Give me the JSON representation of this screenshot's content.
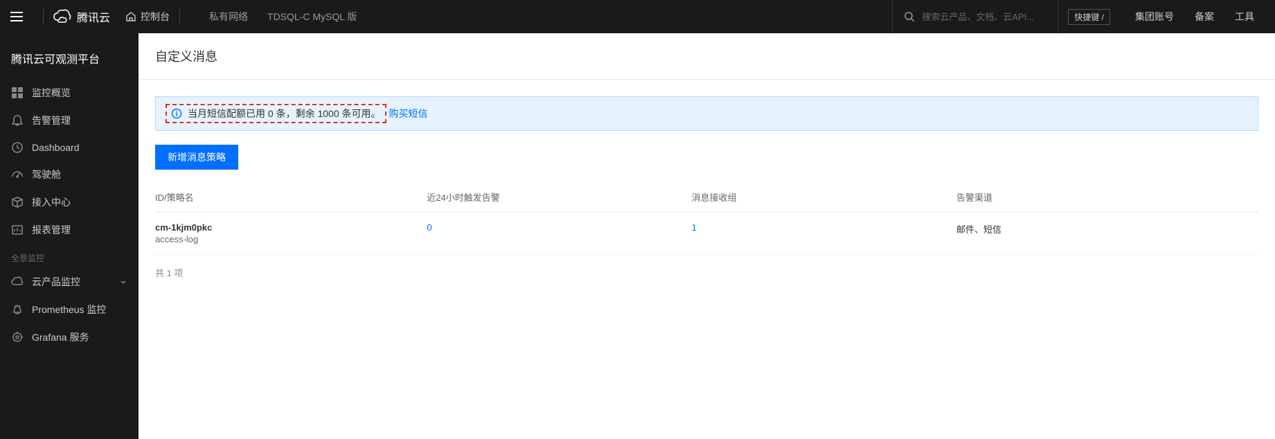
{
  "header": {
    "brand": "腾讯云",
    "console": "控制台",
    "nav": [
      "私有网络",
      "TDSQL-C MySQL 版"
    ],
    "search_placeholder": "搜索云产品、文档、云API...",
    "shortcut": "快捷键 /",
    "right_links": [
      "集团账号",
      "备案",
      "工具"
    ]
  },
  "sidebar": {
    "title": "腾讯云可观测平台",
    "items": [
      {
        "icon": "grid",
        "label": "监控概览"
      },
      {
        "icon": "bell",
        "label": "告警管理"
      },
      {
        "icon": "clock",
        "label": "Dashboard"
      },
      {
        "icon": "gauge",
        "label": "驾驶舱"
      },
      {
        "icon": "box",
        "label": "接入中心"
      },
      {
        "icon": "report",
        "label": "报表管理"
      }
    ],
    "section_label": "全景监控",
    "items2": [
      {
        "icon": "cloud",
        "label": "云产品监控",
        "expandable": true
      },
      {
        "icon": "prom",
        "label": "Prometheus 监控"
      },
      {
        "icon": "grafana",
        "label": "Grafana 服务"
      }
    ]
  },
  "page": {
    "title": "自定义消息"
  },
  "banner": {
    "text": "当月短信配额已用 0 条，剩余 1000 条可用。",
    "link": "购买短信"
  },
  "actions": {
    "create": "新增消息策略"
  },
  "table": {
    "headers": [
      "ID/策略名",
      "近24小时触发告警",
      "消息接收组",
      "告警渠道"
    ],
    "rows": [
      {
        "id": "cm-1kjm0pkc",
        "name": "access-log",
        "alarm24h": "0",
        "groups": "1",
        "channels": "邮件、短信"
      }
    ],
    "footer": "共 1 项"
  }
}
